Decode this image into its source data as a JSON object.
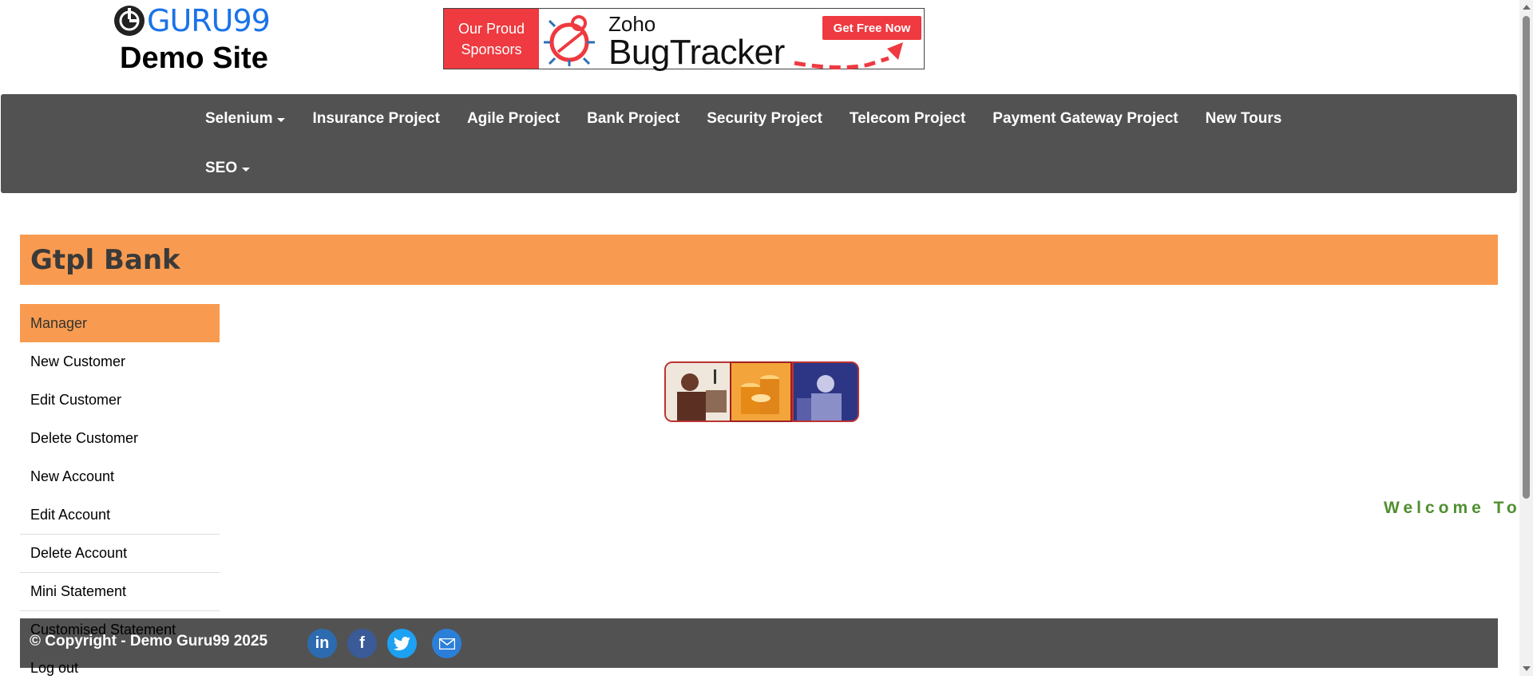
{
  "header": {
    "logo_brand": "GURU99",
    "logo_sub": "Demo Site",
    "sponsor_tag_line1": "Our Proud",
    "sponsor_tag_line2": "Sponsors",
    "sponsor_zoho": "Zoho",
    "sponsor_product": "BugTracker",
    "sponsor_cta": "Get Free Now"
  },
  "nav": {
    "row1": [
      {
        "label": "Selenium",
        "dropdown": true
      },
      {
        "label": "Insurance Project"
      },
      {
        "label": "Agile Project"
      },
      {
        "label": "Bank Project"
      },
      {
        "label": "Security Project"
      },
      {
        "label": "Telecom Project"
      },
      {
        "label": "Payment Gateway Project"
      },
      {
        "label": "New Tours"
      }
    ],
    "row2": [
      {
        "label": "SEO",
        "dropdown": true
      }
    ]
  },
  "bank": {
    "title": "Gtpl Bank"
  },
  "sidebar": {
    "items": [
      {
        "label": "Manager"
      },
      {
        "label": "New Customer"
      },
      {
        "label": "Edit Customer"
      },
      {
        "label": "Delete Customer"
      },
      {
        "label": "New Account"
      },
      {
        "label": "Edit Account"
      },
      {
        "label": "Delete Account"
      },
      {
        "label": "Mini Statement"
      },
      {
        "label": "Customised Statement"
      },
      {
        "label": "Log out"
      }
    ]
  },
  "main": {
    "welcome_marquee": "Welcome To"
  },
  "footer": {
    "copyright": "© Copyright - Demo Guru99 2025",
    "social": [
      "linkedin-icon",
      "facebook-icon",
      "twitter-icon",
      "email-icon"
    ]
  },
  "colors": {
    "nav_bg": "#525252",
    "accent_orange": "#f89b50",
    "brand_blue": "#1a73e8",
    "sponsor_red": "#ee3a40",
    "welcome_green": "#4f8f2f"
  }
}
